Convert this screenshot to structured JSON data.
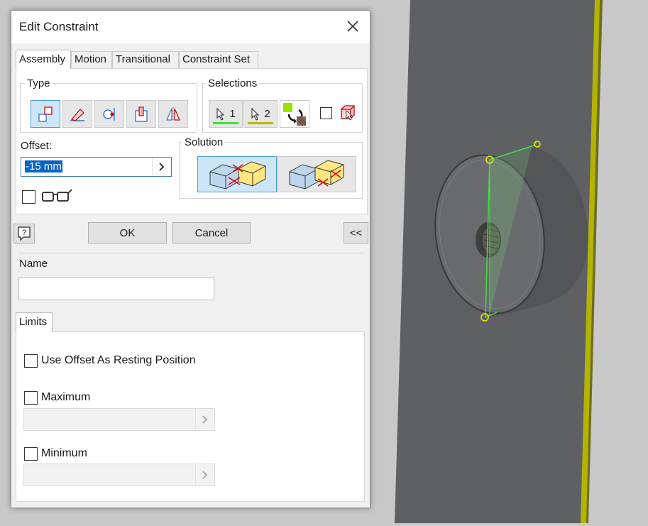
{
  "dialog": {
    "title": "Edit Constraint",
    "tabs": [
      "Assembly",
      "Motion",
      "Transitional",
      "Constraint Set"
    ],
    "active_tab": "Assembly",
    "type": {
      "label": "Type",
      "buttons": [
        "mate-icon",
        "angle-icon",
        "tangent-icon",
        "insert-icon",
        "symmetry-icon"
      ],
      "selected": "mate-icon"
    },
    "selections": {
      "label": "Selections",
      "first": "1",
      "second": "2",
      "first_color": "#33e633",
      "second_color": "#b8b800"
    },
    "offset": {
      "label": "Offset:",
      "value": "-15 mm"
    },
    "solution": {
      "label": "Solution",
      "options": [
        "mate-solution-icon",
        "flush-solution-icon"
      ],
      "selected": "mate-solution-icon"
    },
    "buttons": {
      "help": "?",
      "ok": "OK",
      "cancel": "Cancel",
      "collapse": "<<"
    },
    "name": {
      "label": "Name",
      "value": ""
    },
    "limits": {
      "tab": "Limits",
      "use_offset": "Use Offset As Resting Position",
      "maximum": "Maximum",
      "minimum": "Minimum"
    }
  },
  "colors": {
    "accent": "#0a64c8",
    "selection_highlight": "#cde6f7",
    "constraint_green": "#33e633",
    "edge_yellow": "#b8b800",
    "viewport_bg": "#c9c9c9",
    "part_gray": "#5f6064"
  }
}
